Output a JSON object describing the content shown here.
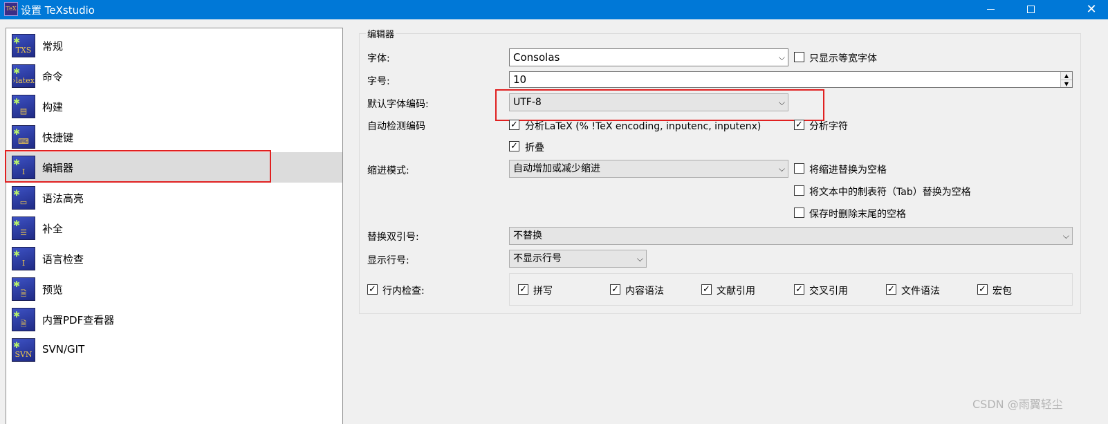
{
  "window": {
    "title": "设置 TeXstudio",
    "icon_text": "TeX",
    "minimize_symbol": "",
    "close_symbol": "✕"
  },
  "sidebar": {
    "items": [
      {
        "label": "常规",
        "icon_text": "TXS",
        "icon": "txs-icon"
      },
      {
        "label": "命令",
        "icon_text": "›latex",
        "icon": "latex-command-icon"
      },
      {
        "label": "构建",
        "icon_text": "▤",
        "icon": "build-icon"
      },
      {
        "label": "快捷键",
        "icon_text": "⌨",
        "icon": "keyboard-icon"
      },
      {
        "label": "编辑器",
        "icon_text": "I",
        "icon": "text-cursor-icon",
        "selected": true
      },
      {
        "label": "语法高亮",
        "icon_text": "▭",
        "icon": "syntax-highlight-icon"
      },
      {
        "label": "补全",
        "icon_text": "☰",
        "icon": "completion-icon"
      },
      {
        "label": "语言检查",
        "icon_text": "I",
        "icon": "language-check-icon"
      },
      {
        "label": "预览",
        "icon_text": "🗎",
        "icon": "preview-icon"
      },
      {
        "label": "内置PDF查看器",
        "icon_text": "🗎",
        "icon": "pdf-viewer-icon"
      },
      {
        "label": "SVN/GIT",
        "icon_text": "SVN",
        "icon": "svn-git-icon"
      }
    ]
  },
  "editor": {
    "group_title": "编辑器",
    "font": {
      "label": "字体:",
      "value": "Consolas",
      "mono_only_label": "只显示等宽字体",
      "mono_only_checked": false
    },
    "font_size": {
      "label": "字号:",
      "value": "10"
    },
    "default_encoding": {
      "label": "默认字体编码:",
      "value": "UTF-8"
    },
    "auto_detect": {
      "label": "自动检测编码",
      "analyze_latex": {
        "label": "分析LaTeX (% !TeX encoding, inputenc, inputenx)",
        "checked": true
      },
      "analyze_chars": {
        "label": "分析字符",
        "checked": true
      },
      "fold": {
        "label": "折叠",
        "checked": true
      }
    },
    "indent": {
      "label": "缩进模式:",
      "value": "自动增加或减少缩进",
      "replace_indent_label": "将缩进替换为空格",
      "replace_tab_label": "将文本中的制表符（Tab）替换为空格",
      "remove_trailing_label": "保存时删除末尾的空格"
    },
    "quotes": {
      "label": "替换双引号:",
      "value": "不替换"
    },
    "line_numbers": {
      "label": "显示行号:",
      "value": "不显示行号"
    },
    "inline_check": {
      "label": "行内检查:",
      "checked": true,
      "options": [
        "拼写",
        "内容语法",
        "文献引用",
        "交叉引用",
        "文件语法",
        "宏包"
      ]
    },
    "check_mark": "✓",
    "dropdown_arrow": "⌵",
    "spin_up": "▲",
    "spin_down": "▼"
  },
  "watermark": "CSDN @雨翼轻尘",
  "colors": {
    "titlebar": "#0078d7",
    "highlight_border": "#e02020",
    "selection": "#dcdcdc"
  }
}
